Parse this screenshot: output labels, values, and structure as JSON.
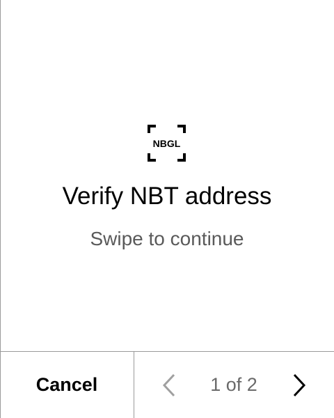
{
  "screen": {
    "logo_icon": "nbgl-logo-icon",
    "logo_text": "NBGL",
    "title": "Verify NBT address",
    "subtitle": "Swipe to continue"
  },
  "footer": {
    "cancel_label": "Cancel",
    "page_indicator": "1 of 2",
    "prev_icon": "chevron-left-icon",
    "next_icon": "chevron-right-icon",
    "prev_enabled": false,
    "next_enabled": true
  },
  "colors": {
    "background": "#ffffff",
    "text_primary": "#000000",
    "text_secondary": "#5a5a5a",
    "disabled": "#a0a0a0",
    "divider": "#9a9a9a"
  }
}
